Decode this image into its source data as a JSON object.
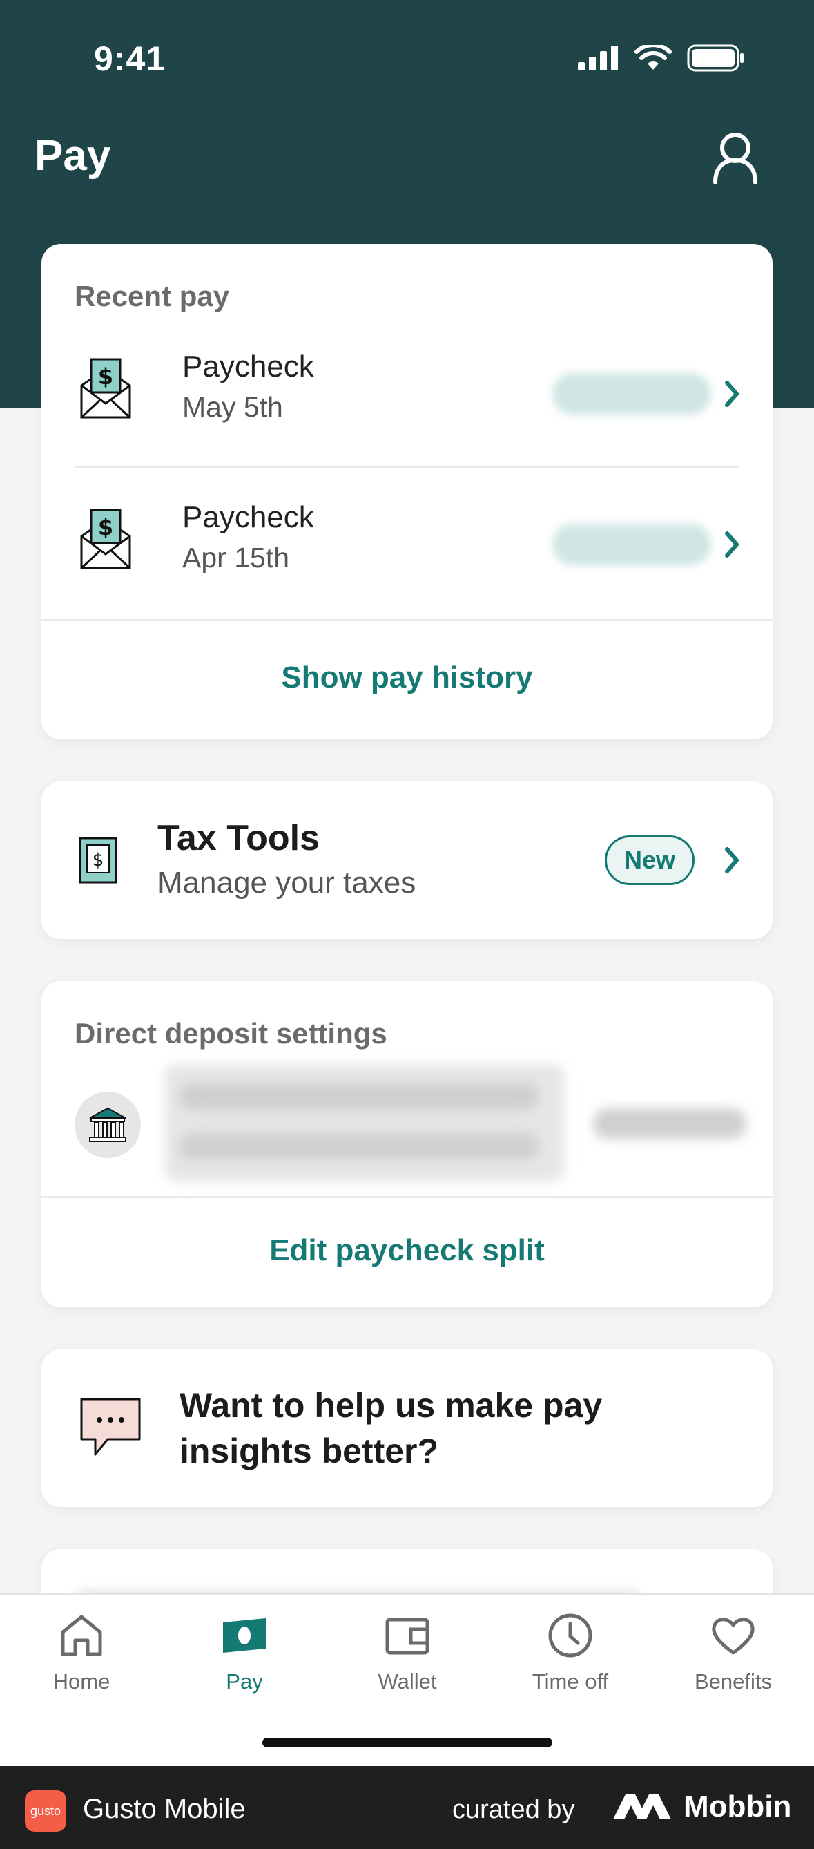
{
  "status_bar": {
    "time": "9:41"
  },
  "header": {
    "title": "Pay"
  },
  "recent_pay": {
    "title": "Recent pay",
    "items": [
      {
        "label": "Paycheck",
        "date": "May 5th"
      },
      {
        "label": "Paycheck",
        "date": "Apr 15th"
      }
    ],
    "show_history": "Show pay history"
  },
  "tax_tools": {
    "title": "Tax Tools",
    "subtitle": "Manage your taxes",
    "badge": "New"
  },
  "direct_deposit": {
    "title": "Direct deposit settings",
    "edit_split": "Edit paycheck split"
  },
  "feedback": {
    "text": "Want to help us make pay insights better?"
  },
  "tabs": [
    {
      "label": "Home",
      "icon": "home-icon"
    },
    {
      "label": "Pay",
      "icon": "pay-icon"
    },
    {
      "label": "Wallet",
      "icon": "wallet-icon"
    },
    {
      "label": "Time off",
      "icon": "clock-icon"
    },
    {
      "label": "Benefits",
      "icon": "heart-icon"
    }
  ],
  "footer": {
    "app_name": "Gusto Mobile",
    "logo_text": "gusto",
    "curated_by": "curated by",
    "brand": "Mobbin"
  },
  "colors": {
    "header_bg": "#1f4548",
    "accent": "#157a73"
  }
}
